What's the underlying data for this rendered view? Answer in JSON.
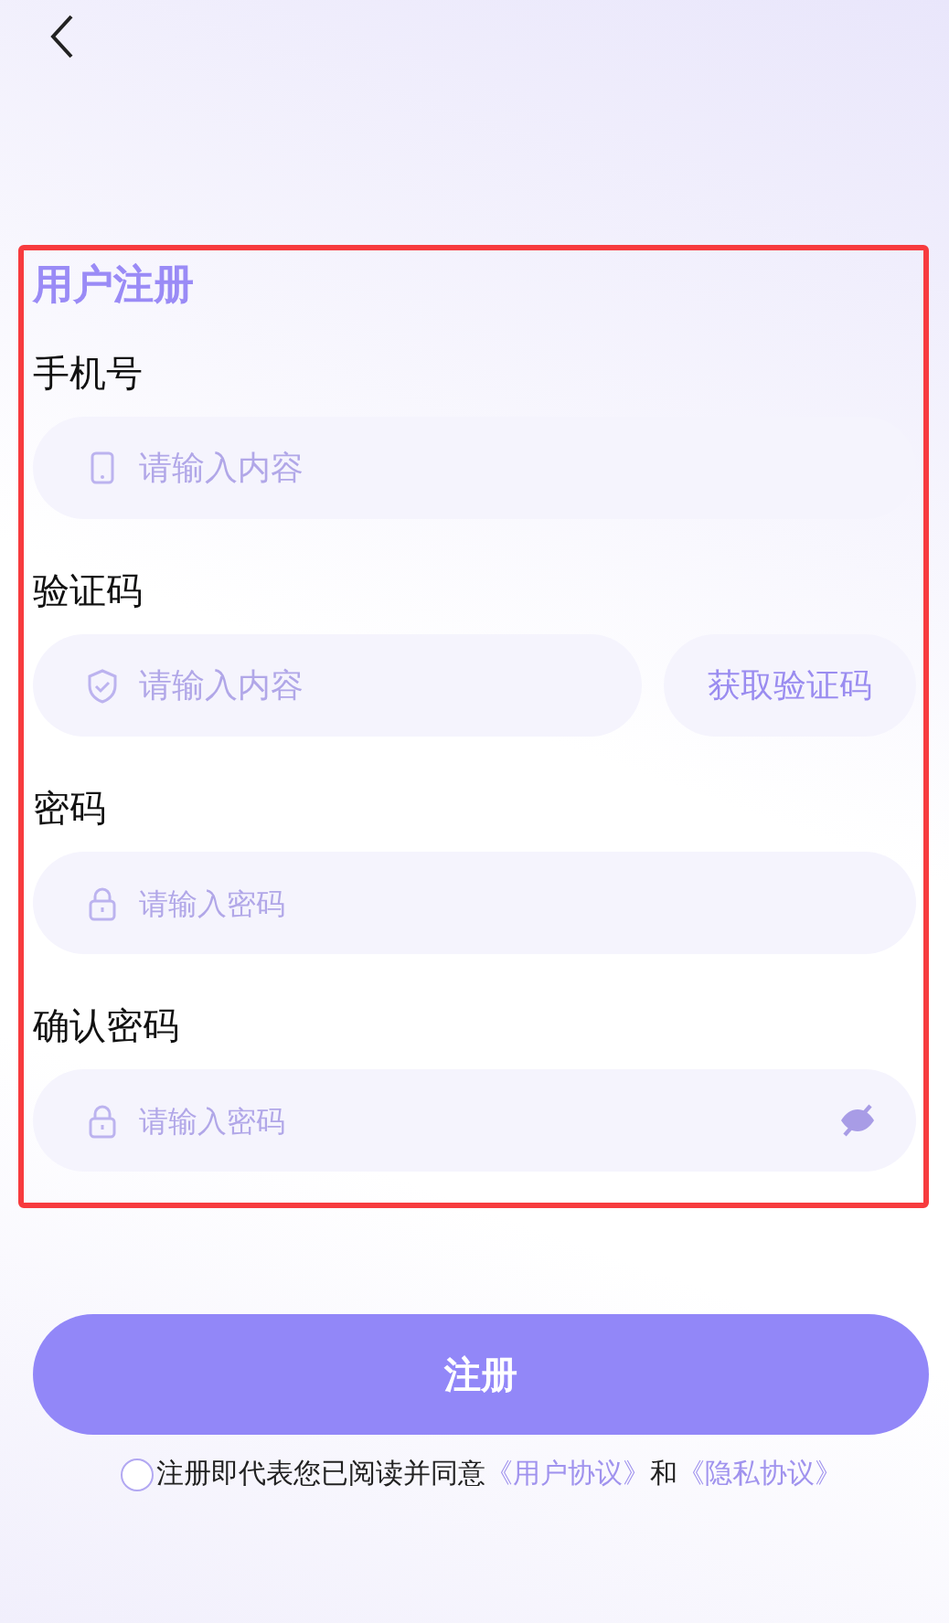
{
  "form": {
    "title": "用户注册",
    "fields": [
      {
        "kind": "phone",
        "label": "手机号",
        "placeholder": "请输入内容"
      },
      {
        "kind": "code",
        "label": "验证码",
        "placeholder": "请输入内容",
        "action": "获取验证码"
      },
      {
        "kind": "password",
        "label": "密码",
        "placeholder": "请输入密码"
      },
      {
        "kind": "password",
        "label": "确认密码",
        "placeholder": "请输入密码",
        "password_visible": false
      }
    ]
  },
  "submit": "注册",
  "agreement": {
    "checked": false,
    "text": "注册即代表您已阅读并同意",
    "links": [
      "《用户协议》",
      "《隐私协议》"
    ],
    "joiner": "和"
  }
}
